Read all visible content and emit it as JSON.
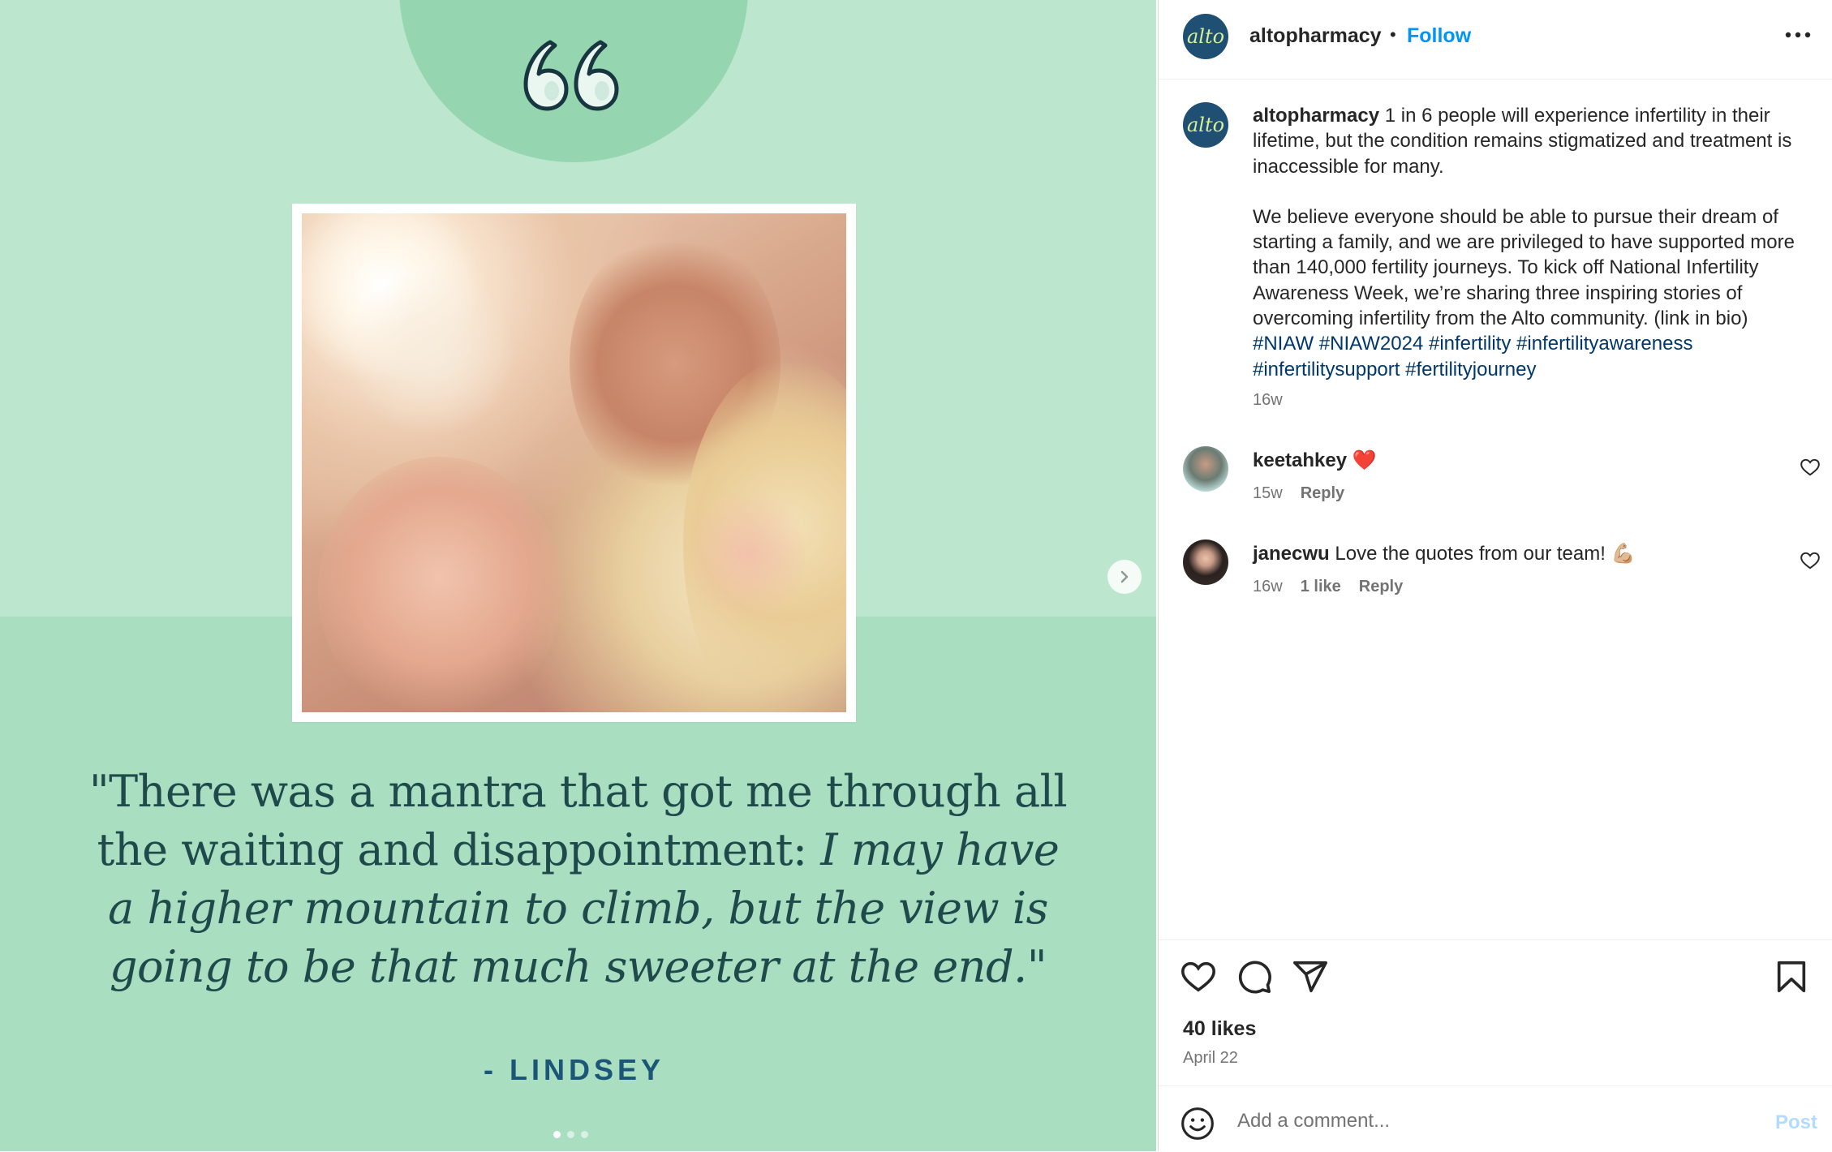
{
  "post_image": {
    "quote_line_1": "\"There was a mantra that got me through all",
    "quote_line_2_roman": "the waiting and disappointment: ",
    "quote_line_2_italic": "I may have",
    "quote_line_3_italic": "a higher mountain to climb, but the view is",
    "quote_line_4_italic": "going to be that much sweeter at the end.\"",
    "attribution": "- LINDSEY",
    "carousel_dots": 3,
    "active_dot": 1
  },
  "header": {
    "avatar_text": "alto",
    "username": "altopharmacy",
    "separator": "•",
    "follow_label": "Follow"
  },
  "caption": {
    "avatar_text": "alto",
    "username": "altopharmacy",
    "text_1": " 1 in 6 people will experience infertility in their lifetime, but the condition remains stigmatized and treatment is inaccessible for many.",
    "text_2": "We believe everyone should be able to pursue their dream of starting a family, and we are privileged to have supported more than 140,000 fertility journeys. To kick off National Infertility Awareness Week, we’re sharing three inspiring stories of overcoming infertility from the Alto community. (link in bio) ",
    "hashtags": [
      "#NIAW",
      "#NIAW2024",
      "#infertility",
      "#infertilityawareness",
      "#infertilitysupport",
      "#fertilityjourney"
    ],
    "time": "16w"
  },
  "comments": [
    {
      "username": "keetahkey",
      "text": " ❤️",
      "time": "15w",
      "likes": "",
      "reply_label": "Reply"
    },
    {
      "username": "janecwu",
      "text": " Love the quotes from our team! 💪🏼",
      "time": "16w",
      "likes": "1 like",
      "reply_label": "Reply"
    }
  ],
  "actions": {
    "likes": "40 likes",
    "date": "April 22"
  },
  "comment_box": {
    "placeholder": "Add a comment...",
    "post_label": "Post"
  },
  "colors": {
    "follow_blue": "#0095f6",
    "hashtag": "#00376b",
    "media_green": "#a9dfc0",
    "quote_text": "#1e4a4c",
    "attribution": "#1b5577"
  },
  "icons": {
    "quote_mark": "quote-mark-icon",
    "next": "chevron-right-icon",
    "more": "more-horizontal-icon",
    "like": "heart-icon",
    "comment": "comment-bubble-icon",
    "share": "paper-plane-icon",
    "save": "bookmark-icon",
    "emoji": "emoji-icon"
  }
}
